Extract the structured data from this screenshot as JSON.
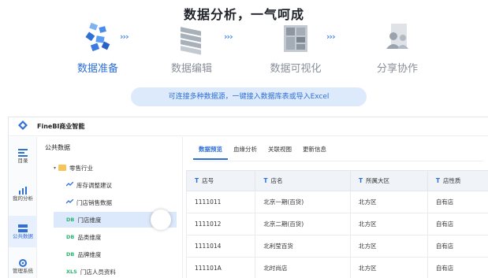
{
  "hero": {
    "title": "数据分析，一气呵成",
    "steps": [
      {
        "label": "数据准备",
        "icon": "data-prep-icon",
        "active": true
      },
      {
        "label": "数据编辑",
        "icon": "data-edit-icon",
        "active": false
      },
      {
        "label": "数据可视化",
        "icon": "data-visualization-icon",
        "active": false
      },
      {
        "label": "分享协作",
        "icon": "share-collaborate-icon",
        "active": false
      }
    ],
    "chevrons": "›››",
    "hint": "可连接多种数据源，一键接入数据库表或导入Excel"
  },
  "app": {
    "title": "FineBI商业智能",
    "rail": [
      {
        "label": "目录",
        "icon": "catalog-icon"
      },
      {
        "label": "我的分析",
        "icon": "my-analysis-icon"
      },
      {
        "label": "公共数据",
        "icon": "public-data-icon",
        "active": true
      },
      {
        "label": "管理系统",
        "icon": "admin-system-icon"
      }
    ],
    "tree": {
      "heading": "公共数据",
      "folder": "零售行业",
      "items": [
        {
          "tag": "~",
          "tag_type": "line",
          "label": "库存调整建议"
        },
        {
          "tag": "~",
          "tag_type": "line",
          "label": "门店销售数据"
        },
        {
          "tag": "DB",
          "tag_type": "db",
          "label": "门店维度",
          "selected": true
        },
        {
          "tag": "DB",
          "tag_type": "db",
          "label": "品类维度"
        },
        {
          "tag": "DB",
          "tag_type": "db",
          "label": "品牌维度"
        },
        {
          "tag": "XLS",
          "tag_type": "xls",
          "label": "门店人员资料"
        }
      ]
    },
    "tabs": [
      "数据预览",
      "血缘分析",
      "关联视图",
      "更新信息"
    ],
    "table": {
      "type_icon": "T",
      "columns": [
        "店号",
        "店名",
        "所属大区",
        "店性质"
      ],
      "rows": [
        [
          "1111011",
          "北京一期(百货)",
          "北方区",
          "自有店"
        ],
        [
          "1111012",
          "北京二期(百货)",
          "北方区",
          "自有店"
        ],
        [
          "1111014",
          "北利莹百货",
          "北方区",
          "自有店"
        ],
        [
          "111101A",
          "北时尚店",
          "北方区",
          "自有店"
        ]
      ]
    }
  },
  "colors": {
    "accent": "#2f6fd6",
    "pill_bg": "#dceafc",
    "db_tag": "#2bb673"
  }
}
